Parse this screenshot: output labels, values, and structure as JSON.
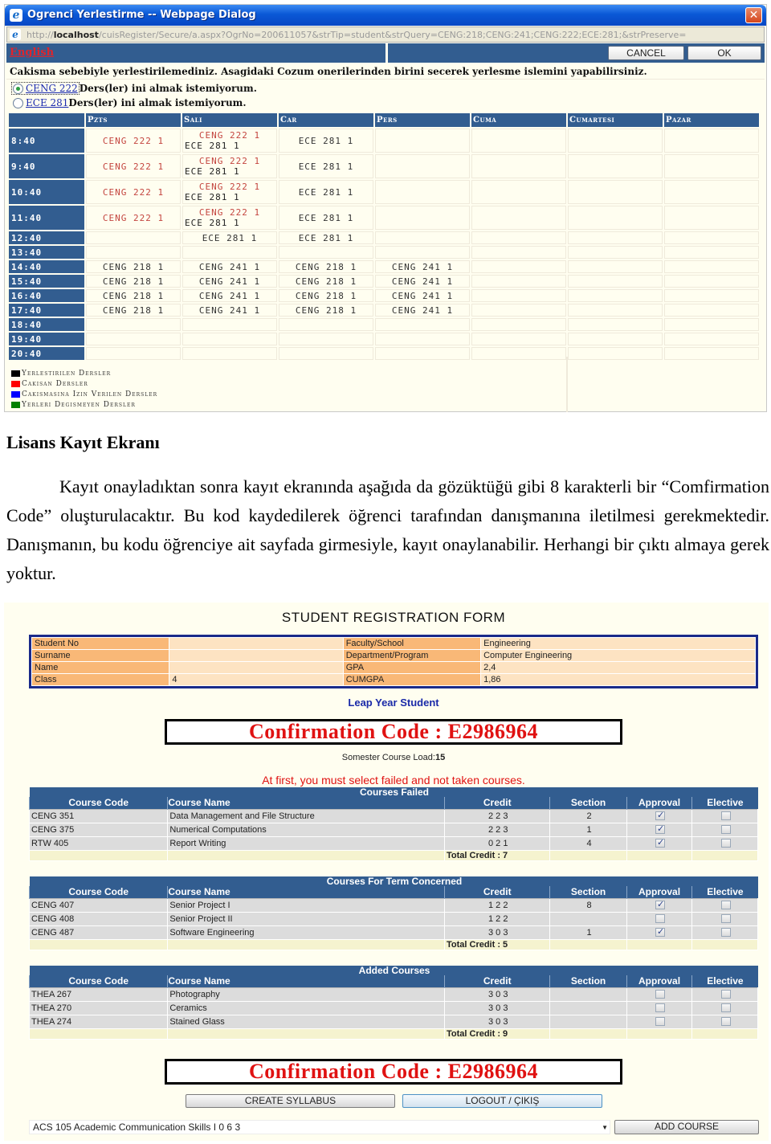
{
  "dialog": {
    "title": "Ogrenci Yerlestirme -- Webpage Dialog",
    "url_prefix": "http://",
    "url_host": "localhost",
    "url_rest": "/cuisRegister/Secure/a.aspx?OgrNo=200611057&strTip=student&strQuery=CENG:218;CENG:241;CENG:222;ECE:281;&strPreserve=",
    "english_link": "English",
    "cancel_label": "CANCEL",
    "ok_label": "OK",
    "message": "Cakisma sebebiyle yerlestirilemediniz. Asagidaki Cozum onerilerinden birini secerek yerlesme islemini yapabilirsiniz.",
    "options": [
      {
        "course": "CENG 222",
        "text": "Ders(ler) ini almak istemiyorum.",
        "selected": true
      },
      {
        "course": "ECE 281",
        "text": "Ders(ler) ini almak istemiyorum.",
        "selected": false
      }
    ],
    "schedule": {
      "days": [
        "Pzts",
        "Sali",
        "Car",
        "Pers",
        "Cuma",
        "Cumartesi",
        "Pazar"
      ],
      "rows": [
        {
          "time": "8:40",
          "cells": [
            [
              "CENG 222 1"
            ],
            [
              "CENG 222 1",
              "ECE 281 1"
            ],
            [
              "ECE 281 1"
            ],
            [],
            [],
            [],
            []
          ]
        },
        {
          "time": "9:40",
          "cells": [
            [
              "CENG 222 1"
            ],
            [
              "CENG 222 1",
              "ECE 281 1"
            ],
            [
              "ECE 281 1"
            ],
            [],
            [],
            [],
            []
          ]
        },
        {
          "time": "10:40",
          "cells": [
            [
              "CENG 222 1"
            ],
            [
              "CENG 222 1",
              "ECE 281 1"
            ],
            [
              "ECE 281 1"
            ],
            [],
            [],
            [],
            []
          ]
        },
        {
          "time": "11:40",
          "cells": [
            [
              "CENG 222 1"
            ],
            [
              "CENG 222 1",
              "ECE 281 1"
            ],
            [
              "ECE 281 1"
            ],
            [],
            [],
            [],
            []
          ]
        },
        {
          "time": "12:40",
          "cells": [
            [],
            [
              "ECE 281 1"
            ],
            [
              "ECE 281 1"
            ],
            [],
            [],
            [],
            []
          ]
        },
        {
          "time": "13:40",
          "cells": [
            [],
            [],
            [],
            [],
            [],
            [],
            []
          ]
        },
        {
          "time": "14:40",
          "cells": [
            [
              "CENG 218 1"
            ],
            [
              "CENG 241 1"
            ],
            [
              "CENG 218 1"
            ],
            [
              "CENG 241 1"
            ],
            [],
            [],
            []
          ]
        },
        {
          "time": "15:40",
          "cells": [
            [
              "CENG 218 1"
            ],
            [
              "CENG 241 1"
            ],
            [
              "CENG 218 1"
            ],
            [
              "CENG 241 1"
            ],
            [],
            [],
            []
          ]
        },
        {
          "time": "16:40",
          "cells": [
            [
              "CENG 218 1"
            ],
            [
              "CENG 241 1"
            ],
            [
              "CENG 218 1"
            ],
            [
              "CENG 241 1"
            ],
            [],
            [],
            []
          ]
        },
        {
          "time": "17:40",
          "cells": [
            [
              "CENG 218 1"
            ],
            [
              "CENG 241 1"
            ],
            [
              "CENG 218 1"
            ],
            [
              "CENG 241 1"
            ],
            [],
            [],
            []
          ]
        },
        {
          "time": "18:40",
          "cells": [
            [],
            [],
            [],
            [],
            [],
            [],
            []
          ]
        },
        {
          "time": "19:40",
          "cells": [
            [],
            [],
            [],
            [],
            [],
            [],
            []
          ]
        },
        {
          "time": "20:40",
          "cells": [
            [],
            [],
            [],
            [],
            [],
            [],
            []
          ]
        }
      ]
    },
    "legend": [
      {
        "label": "Yerlestirilen Dersler",
        "color": "#000000"
      },
      {
        "label": "Cakisan Dersler",
        "color": "#ff0000"
      },
      {
        "label": "Cakismasina Izin Verilen Dersler",
        "color": "#0000ff"
      },
      {
        "label": "Yerleri Degismeyen Dersler",
        "color": "#008000"
      }
    ]
  },
  "document": {
    "heading": "Lisans Kayıt Ekranı",
    "paragraph": "Kayıt onayladıktan sonra kayıt ekranında aşağıda da gözüktüğü gibi 8 karakterli bir “Comfirmation Code” oluşturulacaktır. Bu kod kaydedilerek öğrenci tarafından danışmanına iletilmesi gerekmektedir. Danışmanın, bu kodu öğrenciye ait sayfada girmesiyle, kayıt onaylanabilir. Herhangi bir çıktı almaya gerek yoktur."
  },
  "registration": {
    "title": "STUDENT REGISTRATION FORM",
    "info": [
      {
        "label": "Student No",
        "value": "",
        "label2": "Faculty/School",
        "value2": "Engineering"
      },
      {
        "label": "Surname",
        "value": "",
        "label2": "Department/Program",
        "value2": "Computer Engineering"
      },
      {
        "label": "Name",
        "value": "",
        "label2": "GPA",
        "value2": "2,4"
      },
      {
        "label": "Class",
        "value": "4",
        "label2": "CUMGPA",
        "value2": "1,86"
      }
    ],
    "student_type": "Leap Year Student",
    "confirmation_code": "Confirmation Code : E2986964",
    "load_label": "Somester Course Load:",
    "load_value": "15",
    "warning": "At first, you must select failed and not taken courses.",
    "columns": [
      "Course Code",
      "Course Name",
      "Credit",
      "Section",
      "Approval",
      "Elective"
    ],
    "tables": [
      {
        "caption": "Courses Failed",
        "rows": [
          {
            "code": "CENG 351",
            "name": "Data Management and File Structure",
            "credit": "2 2 3",
            "section": "2",
            "approval": true,
            "elective": false
          },
          {
            "code": "CENG 375",
            "name": "Numerical Computations",
            "credit": "2 2 3",
            "section": "1",
            "approval": true,
            "elective": false
          },
          {
            "code": "RTW 405",
            "name": "Report Writing",
            "credit": "0 2 1",
            "section": "4",
            "approval": true,
            "elective": false
          }
        ],
        "total": "Total Credit : 7"
      },
      {
        "caption": "Courses For Term Concerned",
        "rows": [
          {
            "code": "CENG 407",
            "name": "Senior Project I",
            "credit": "1 2 2",
            "section": "8",
            "approval": true,
            "elective": false
          },
          {
            "code": "CENG 408",
            "name": "Senior Project II",
            "credit": "1 2 2",
            "section": "",
            "approval": false,
            "elective": false
          },
          {
            "code": "CENG 487",
            "name": "Software Engineering",
            "credit": "3 0 3",
            "section": "1",
            "approval": true,
            "elective": false
          }
        ],
        "total": "Total Credit : 5"
      },
      {
        "caption": "Added Courses",
        "rows": [
          {
            "code": "THEA 267",
            "name": "Photography",
            "credit": "3 0 3",
            "section": "",
            "approval": false,
            "elective": false
          },
          {
            "code": "THEA 270",
            "name": "Ceramics",
            "credit": "3 0 3",
            "section": "",
            "approval": false,
            "elective": false
          },
          {
            "code": "THEA 274",
            "name": "Stained Glass",
            "credit": "3 0 3",
            "section": "",
            "approval": false,
            "elective": false
          }
        ],
        "total": "Total Credit : 9"
      }
    ],
    "create_syllabus_label": "CREATE SYLLABUS",
    "logout_label": "LOGOUT / ÇIKIŞ",
    "course_select_value": "ACS 105 Academic Communication Skills I 0 6 3",
    "add_course_label": "ADD COURSE"
  }
}
